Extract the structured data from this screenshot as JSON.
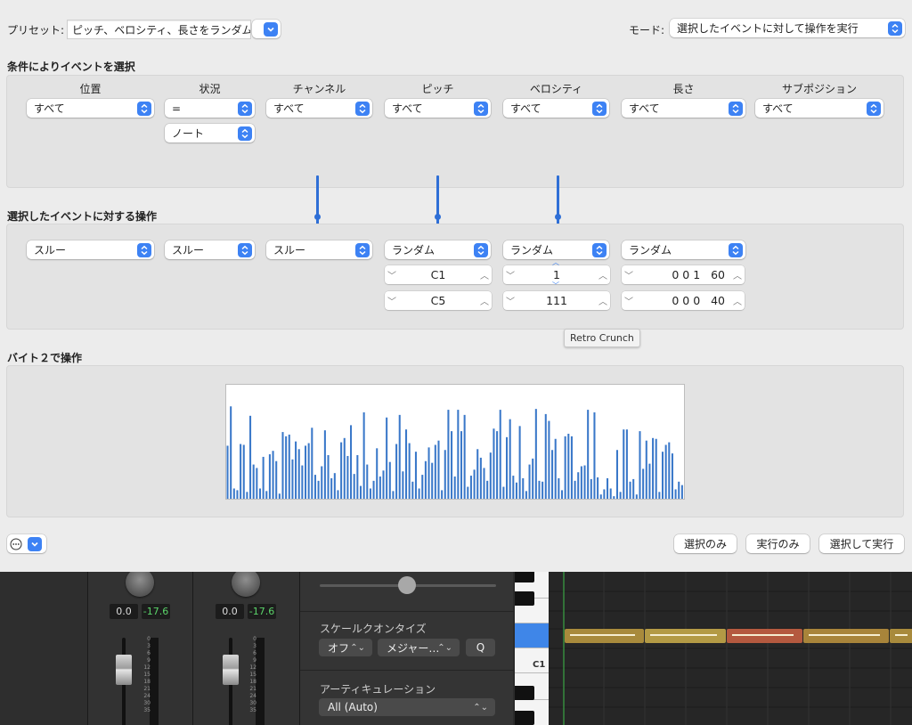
{
  "header": {
    "preset_label": "プリセット:",
    "preset_value": "ピッチ、ベロシティ、長さをランダム",
    "mode_label": "モード:",
    "mode_value": "選択したイベントに対して操作を実行"
  },
  "select_section": {
    "title": "条件によりイベントを選択",
    "columns": [
      {
        "header": "位置",
        "value": "すべて"
      },
      {
        "header": "状況",
        "value": "=",
        "sub_value": "ノート"
      },
      {
        "header": "チャンネル",
        "value": "すべて"
      },
      {
        "header": "ピッチ",
        "value": "すべて"
      },
      {
        "header": "ベロシティ",
        "value": "すべて"
      },
      {
        "header": "長さ",
        "value": "すべて"
      },
      {
        "header": "サブポジション",
        "value": "すべて"
      }
    ]
  },
  "operation_section": {
    "title": "選択したイベントに対する操作",
    "ops": [
      "スルー",
      "スルー",
      "スルー",
      "ランダム",
      "ランダム",
      "ランダム"
    ],
    "pitch_min": "C1",
    "pitch_max": "C5",
    "velocity_min": "1",
    "velocity_max": "111",
    "length_min": "0 0 1   60",
    "length_max": "0 0 0   40"
  },
  "tooltip": "Retro Crunch",
  "byte2_section": {
    "title": "バイト２で操作"
  },
  "footer": {
    "select_only": "選択のみ",
    "operate_only": "実行のみ",
    "select_and_operate": "選択して実行"
  },
  "bottom": {
    "strip1": {
      "pan": "0.0",
      "level": "-17.6"
    },
    "strip2": {
      "pan": "0.0",
      "level": "-17.6"
    },
    "meter_scale": [
      "0",
      "3",
      "6",
      "9",
      "12",
      "15",
      "18",
      "21",
      "24",
      "30",
      "35"
    ],
    "scale_quantize_label": "スケールクオンタイズ",
    "scale_off": "オフ",
    "scale_type": "メジャー…",
    "q_button": "Q",
    "articulation_label": "アーティキュレーション",
    "articulation_value": "All (Auto)",
    "piano_label": "C1"
  },
  "colors": {
    "accent": "#3d82f4",
    "graph_bar": "#3a78c9",
    "note_gold": "#a88a3c",
    "note_red": "#b4593f",
    "level_green": "#5bd46a"
  },
  "chart_data": {
    "type": "bar",
    "title": "",
    "ylim": [
      0,
      127
    ],
    "values": [
      62,
      108,
      12,
      10,
      64,
      63,
      8,
      97,
      40,
      36,
      12,
      49,
      9,
      52,
      56,
      44,
      6,
      78,
      73,
      75,
      46,
      67,
      58,
      39,
      62,
      65,
      83,
      28,
      21,
      38,
      80,
      51,
      24,
      30,
      10,
      66,
      71,
      50,
      86,
      29,
      51,
      15,
      101,
      40,
      12,
      21,
      59,
      26,
      33,
      95,
      43,
      9,
      64,
      98,
      32,
      81,
      65,
      20,
      55,
      12,
      28,
      44,
      60,
      42,
      63,
      68,
      10,
      57,
      104,
      79,
      26,
      104,
      79,
      98,
      14,
      27,
      34,
      58,
      48,
      36,
      21,
      54,
      82,
      79,
      104,
      14,
      72,
      93,
      27,
      19,
      85,
      24,
      9,
      40,
      47,
      105,
      21,
      20,
      99,
      91,
      57,
      70,
      24,
      10,
      73,
      76,
      73,
      21,
      31,
      38,
      39,
      104,
      23,
      101,
      25,
      5,
      11,
      24,
      12,
      3,
      57,
      8,
      81,
      81,
      20,
      23,
      5,
      79,
      35,
      68,
      41,
      71,
      70,
      8,
      55,
      63,
      66,
      53,
      11,
      20,
      16
    ]
  }
}
